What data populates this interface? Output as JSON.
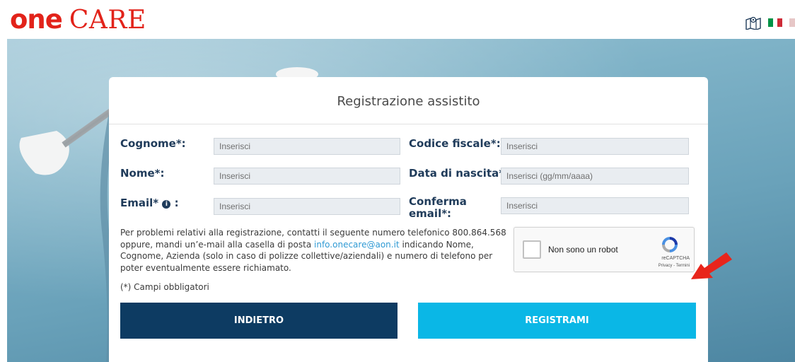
{
  "header": {
    "logo_one": "one",
    "logo_care": "CARE",
    "icons": [
      "map-icon",
      "flag-italy-icon",
      "flag-partial-icon"
    ]
  },
  "form": {
    "title": "Registrazione assistito",
    "fields": {
      "cognome": {
        "label": "Cognome*:",
        "placeholder": "Inserisci"
      },
      "nome": {
        "label": "Nome*:",
        "placeholder": "Inserisci"
      },
      "email": {
        "label": "Email*",
        "label_suffix": ":",
        "placeholder": "Inserisci"
      },
      "codice_fiscale": {
        "label": "Codice fiscale*:",
        "placeholder": "Inserisci"
      },
      "data_nascita": {
        "label": "Data di nascita*:",
        "placeholder": "Inserisci (gg/mm/aaaa)"
      },
      "conferma_email": {
        "label_line1": "Conferma",
        "label_line2": "email*:",
        "placeholder": "Inserisci"
      }
    },
    "help": {
      "part1": "Per problemi relativi alla registrazione, contatti il seguente numero telefonico 800.864.568 oppure, mandi un’e-mail alla casella di posta ",
      "email_link": "info.onecare@aon.it",
      "part2": " indicando Nome, Cognome, Azienda (solo in caso di polizze collettive/aziendali) e numero di telefono per poter eventualmente essere richiamato."
    },
    "required_note": "(*) Campi obbligatori",
    "captcha": {
      "label": "Non sono un robot",
      "brand": "reCAPTCHA",
      "links": "Privacy - Termini"
    },
    "buttons": {
      "back": "INDIETRO",
      "register": "REGISTRAMI"
    }
  },
  "colors": {
    "brand_red": "#e2231a",
    "navy": "#0d3b62",
    "cyan": "#0ab7e6",
    "link": "#2f9ad4",
    "annotation_arrow": "#e8251b"
  }
}
